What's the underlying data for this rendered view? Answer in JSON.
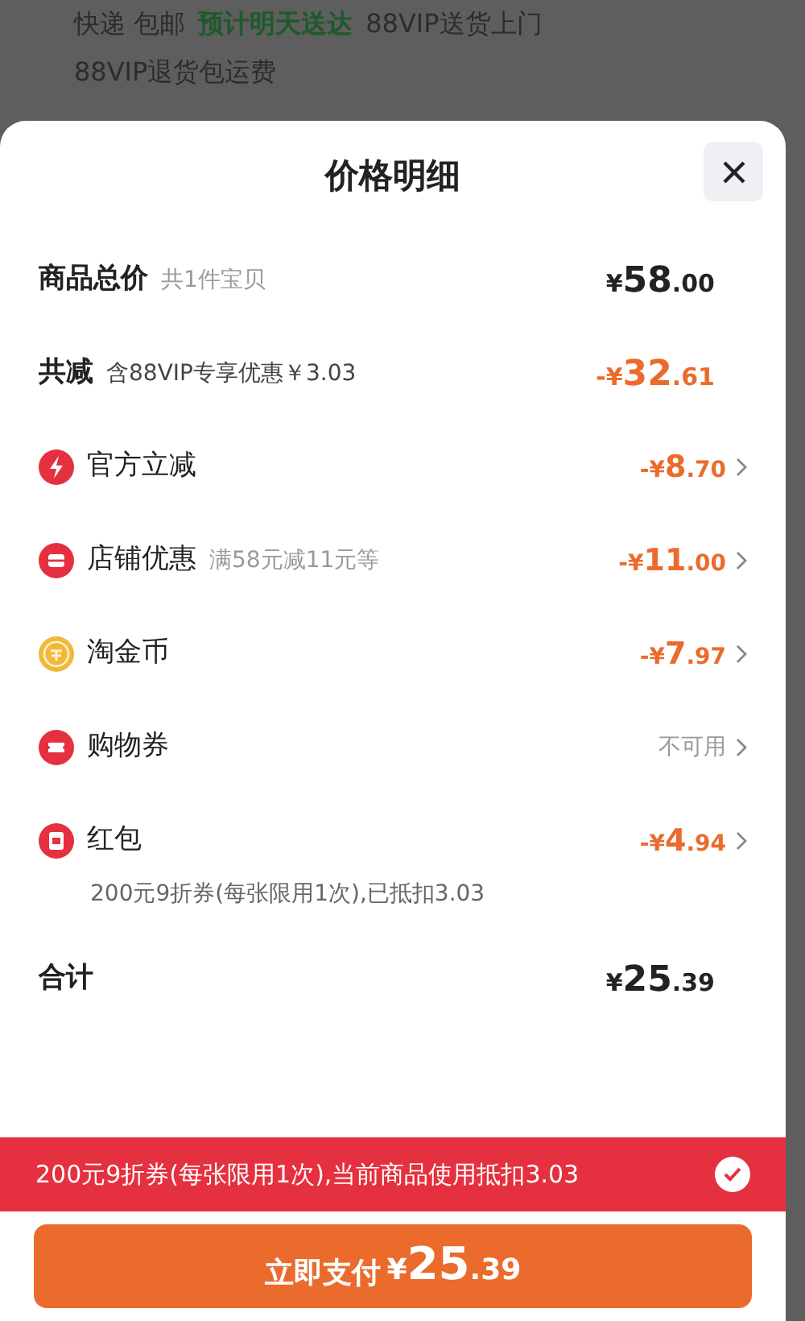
{
  "background": {
    "tags": [
      {
        "text": "快递 包邮",
        "highlight": false
      },
      {
        "text": "预计明天送达",
        "highlight": true
      },
      {
        "text": "88VIP送货上门",
        "highlight": false
      },
      {
        "text": "88VIP退货包运费",
        "highlight": false
      }
    ]
  },
  "sheet": {
    "title": "价格明细",
    "rows": [
      {
        "kind": "total",
        "label": "商品总价",
        "note": "共1件宝贝",
        "amount": "¥58.00",
        "orange": false
      },
      {
        "kind": "total",
        "label": "共减",
        "note": "含88VIP专享优惠￥3.03",
        "amount": "-¥32.61",
        "orange": true
      },
      {
        "kind": "discount",
        "label": "官方立减",
        "amount": "-¥8.70",
        "available": true
      },
      {
        "kind": "discount",
        "label": "店铺优惠",
        "note": "满58元减11元等",
        "amount": "-¥11.00",
        "available": true
      },
      {
        "kind": "discount",
        "label": "淘金币",
        "amount": "-¥7.97",
        "available": true
      },
      {
        "kind": "discount",
        "label": "购物券",
        "amount": "不可用",
        "available": false
      },
      {
        "kind": "discount",
        "label": "红包",
        "amount": "-¥4.94",
        "available": true,
        "detail": "200元9折券(每张限用1次),已抵扣3.03"
      },
      {
        "kind": "total",
        "label": "合计",
        "amount": "¥25.39",
        "orange": false
      }
    ],
    "banner": {
      "text": "200元9折券(每张限用1次),当前商品使用抵扣3.03",
      "checked": true
    },
    "pay_button": {
      "label": "立即支付",
      "amount": "¥25.39"
    }
  }
}
